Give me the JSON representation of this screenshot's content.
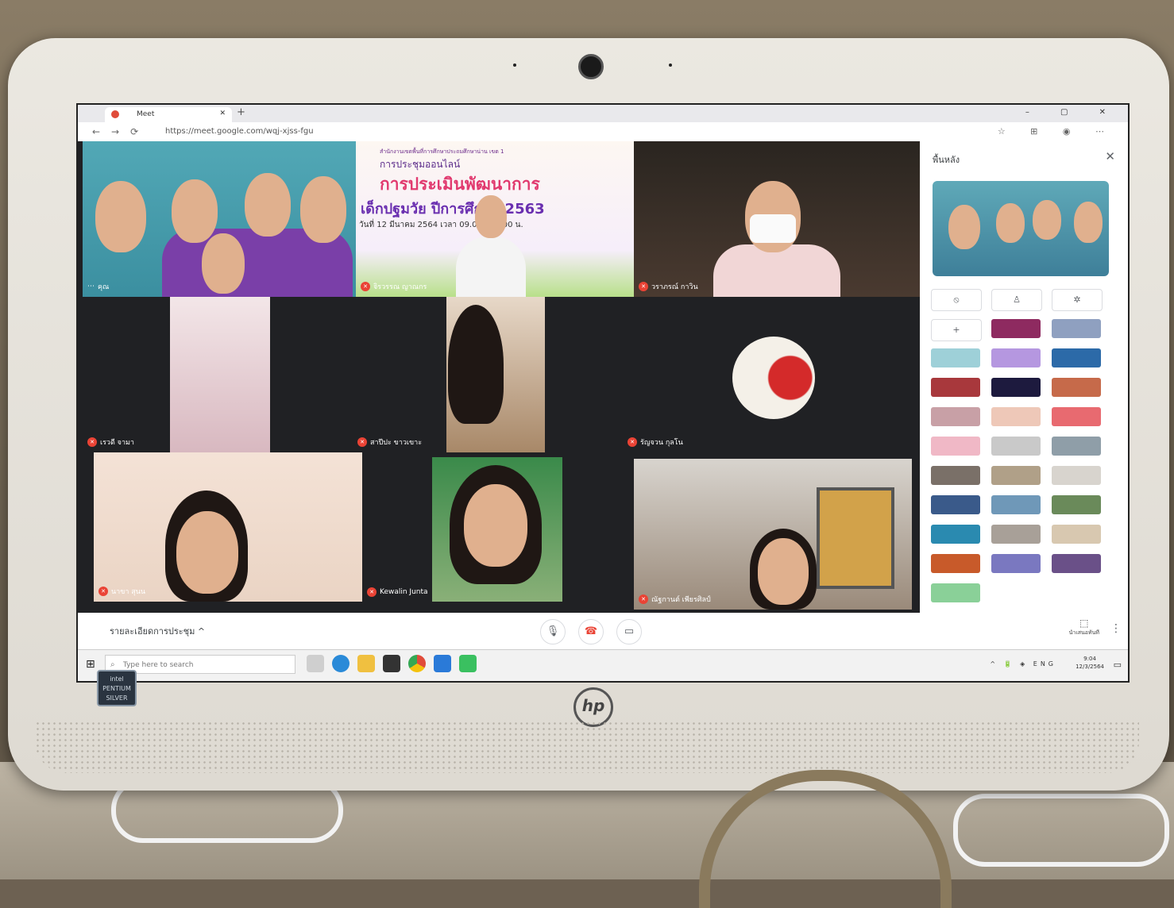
{
  "browser": {
    "tab_title": "Meet",
    "new_tab": "+",
    "url": "https://meet.google.com/wqj-xjss-fgu",
    "window_controls": "–  ▢  ✕"
  },
  "meet": {
    "tiles": [
      {
        "name": "คุณ",
        "muted": false
      },
      {
        "name": "จิรวรรณ ญาณกร",
        "muted": false
      },
      {
        "name": "วราภรณ์ กาวิน",
        "muted": true
      },
      {
        "name": "เรวดี จามา",
        "muted": true
      },
      {
        "name": "สาปีปะ ขาวเขาะ",
        "muted": true
      },
      {
        "name": "รัญจวน กุลโน",
        "muted": true
      },
      {
        "name": "นาขา สุนน",
        "muted": true
      },
      {
        "name": "Kewalin Junta",
        "muted": true
      },
      {
        "name": "ณัฐกานต์ เพียรศิลป์",
        "muted": true
      }
    ],
    "slide": {
      "line1": "สำนักงานเขตพื้นที่การศึกษาประถมศึกษาน่าน เขต 1",
      "line2": "การประชุมออนไลน์",
      "line3": "การประเมินพัฒนาการ",
      "line4": "เด็กปฐมวัย ปีการศึกษา 2563",
      "line5": "วันที่ 12 มีนาคม 2564 เวลา 09.00 - 11.00 น."
    }
  },
  "panel": {
    "title": "พื้นหลัง",
    "close": "✕",
    "options": [
      "⦸",
      "♙",
      "✲"
    ],
    "add": "+",
    "thumb_colors": [
      "#8e2a60",
      "#8fa0c0",
      "#9ed0d8",
      "#b597e0",
      "#2c6aa8",
      "#a8383c",
      "#1d1a3e",
      "#c66a4a",
      "#c8a0a6",
      "#eec8b8",
      "#e86a70",
      "#f0b8c6",
      "#c9c9c9",
      "#8f9ea8",
      "#7a7068",
      "#b0a088",
      "#d8d4ce",
      "#3a5a8a",
      "#6f98b8",
      "#6a8a5a",
      "#2a8ab0",
      "#a8a098",
      "#d8c8b0",
      "#c85a2a",
      "#7a78c0",
      "#6a5088",
      "#8ad098"
    ]
  },
  "controls": {
    "details": "รายละเอียดการประชุม",
    "chevron": "^",
    "mic": "🎙",
    "hangup": "☎",
    "camera": "▭",
    "present_label": "นำเสนอทันที",
    "more": "⋮"
  },
  "taskbar": {
    "search_placeholder": "Type here to search",
    "tray": "^ 🔋 ◈ ENG",
    "time": "9:04",
    "date": "12/3/2564"
  },
  "hardware": {
    "cpu_badge": "intel PENTIUM SILVER",
    "brand": "hp"
  }
}
